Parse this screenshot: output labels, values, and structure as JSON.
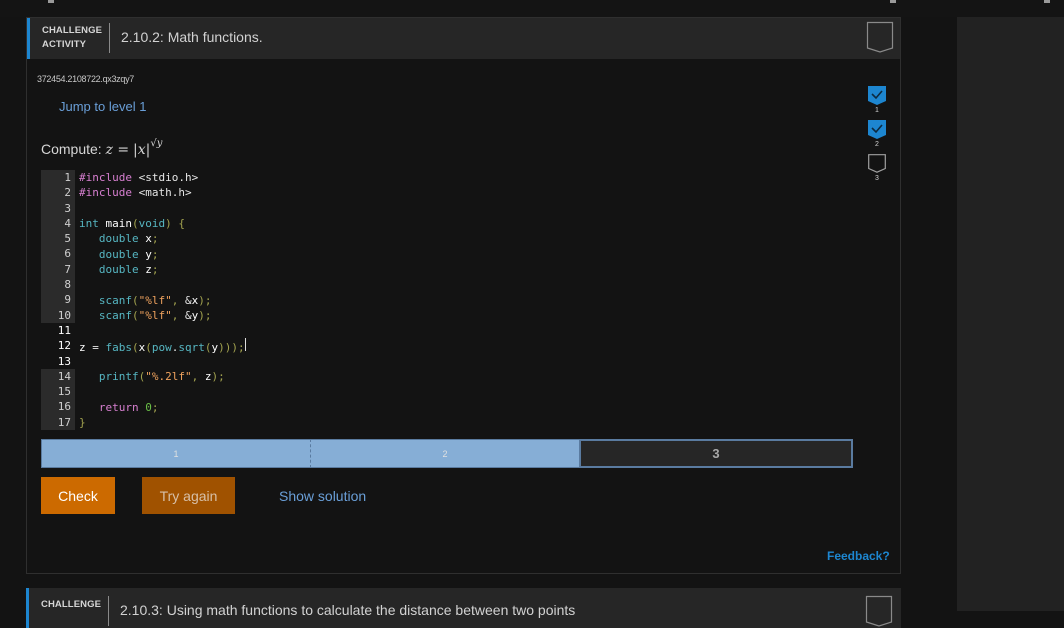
{
  "activity": {
    "label_line1": "CHALLENGE",
    "label_line2": "ACTIVITY",
    "title": "2.10.2: Math functions.",
    "id": "372454.2108722.qx3zqy7",
    "jump_link": "Jump to level 1",
    "compute_prefix": "Compute:",
    "compute_lhs": "z =",
    "compute_base": "|x|",
    "compute_exponent": "√y"
  },
  "code": {
    "lines": [
      {
        "n": "1",
        "editable": false
      },
      {
        "n": "2",
        "editable": false
      },
      {
        "n": "3",
        "editable": false
      },
      {
        "n": "4",
        "editable": false
      },
      {
        "n": "5",
        "editable": false
      },
      {
        "n": "6",
        "editable": false
      },
      {
        "n": "7",
        "editable": false
      },
      {
        "n": "8",
        "editable": false
      },
      {
        "n": "9",
        "editable": false
      },
      {
        "n": "10",
        "editable": false
      },
      {
        "n": "11",
        "editable": true
      },
      {
        "n": "12",
        "editable": true
      },
      {
        "n": "13",
        "editable": true
      },
      {
        "n": "14",
        "editable": false
      },
      {
        "n": "15",
        "editable": false
      },
      {
        "n": "16",
        "editable": false
      },
      {
        "n": "17",
        "editable": false
      }
    ],
    "text": [
      "#include <stdio.h>",
      "#include <math.h>",
      "",
      "int main(void) {",
      "   double x;",
      "   double y;",
      "   double z;",
      "",
      "   scanf(\"%lf\", &x);",
      "   scanf(\"%lf\", &y);",
      "",
      "z = fabs(x(pow.sqrt(y)));",
      "",
      "   printf(\"%.2lf\", z);",
      "",
      "   return 0;",
      "}"
    ]
  },
  "progress": {
    "segments": [
      {
        "label": "1",
        "state": "done"
      },
      {
        "label": "2",
        "state": "done"
      },
      {
        "label": "3",
        "state": "current"
      }
    ]
  },
  "buttons": {
    "check": "Check",
    "try_again": "Try again",
    "show_solution": "Show solution",
    "feedback": "Feedback?"
  },
  "levels": [
    {
      "label": "1",
      "completed": true
    },
    {
      "label": "2",
      "completed": true
    },
    {
      "label": "3",
      "completed": false
    }
  ],
  "next_activity": {
    "label_line1": "CHALLENGE",
    "title": "2.10.3: Using math functions to calculate the distance between two points"
  },
  "colors": {
    "accent": "#1d86d0",
    "check_button": "#cc6a00",
    "try_again_button": "#a05200",
    "progress_done": "#86aed6",
    "link": "#6a9fd8"
  }
}
